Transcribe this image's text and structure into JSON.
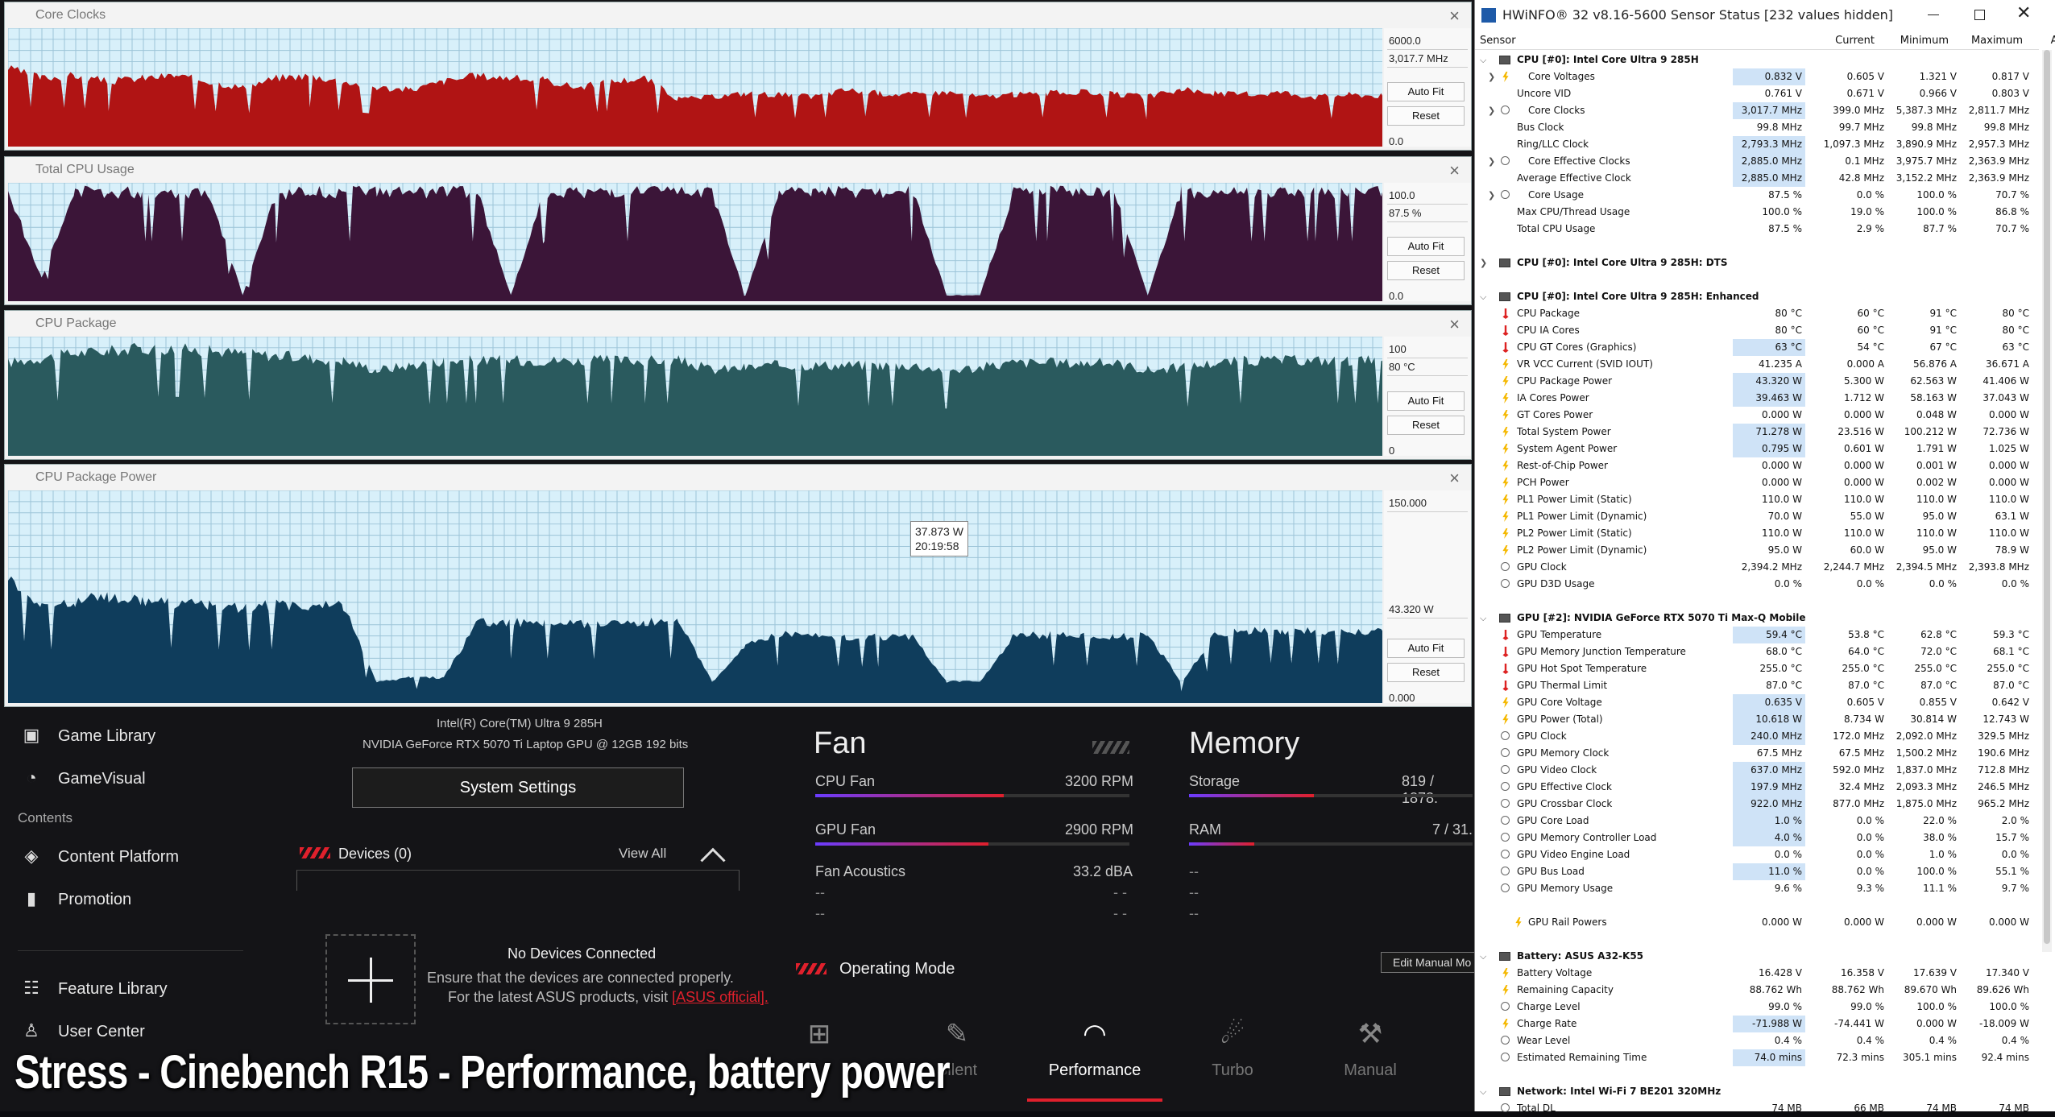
{
  "graphs": [
    {
      "title": "Core Clocks",
      "top_label": "6000.0",
      "current_label": "3,017.7 MHz",
      "bottom_label": "0.0",
      "autofit": "Auto Fit",
      "reset": "Reset",
      "color": "#b01414",
      "series": [
        0.66,
        0.58,
        0.6,
        0.55,
        0.58,
        0.6,
        0.55,
        0.5,
        0.58,
        0.6,
        0.55,
        0.5,
        0.48,
        0.55,
        0.6,
        0.58,
        0.56,
        0.5,
        0.55,
        0.58,
        0.4,
        0.42,
        0.45,
        0.44,
        0.42,
        0.48,
        0.45,
        0.44,
        0.46,
        0.42,
        0.44,
        0.45,
        0.46,
        0.44,
        0.42,
        0.48,
        0.45,
        0.44,
        0.46,
        0.42,
        0.44,
        0.43
      ]
    },
    {
      "title": "Total CPU Usage",
      "top_label": "100.0",
      "current_label": "87.5 %",
      "bottom_label": "0.0",
      "autofit": "Auto Fit",
      "reset": "Reset",
      "color": "#3b1538",
      "series": [
        0.92,
        0.2,
        0.92,
        0.92,
        0.92,
        0.92,
        0.92,
        0.05,
        0.9,
        0.92,
        0.92,
        0.92,
        0.92,
        0.92,
        0.92,
        0.05,
        0.92,
        0.92,
        0.92,
        0.92,
        0.92,
        0.92,
        0.05,
        0.92,
        0.92,
        0.92,
        0.92,
        0.92,
        0.05,
        0.05,
        0.92,
        0.92,
        0.92,
        0.92,
        0.05,
        0.92,
        0.92,
        0.92,
        0.92,
        0.92,
        0.92,
        0.92
      ]
    },
    {
      "title": "CPU Package",
      "top_label": "100",
      "current_label": "80 °C",
      "bottom_label": "0",
      "autofit": "Auto Fit",
      "reset": "Reset",
      "color": "#2a5a5e",
      "series": [
        0.78,
        0.82,
        0.86,
        0.88,
        0.9,
        0.9,
        0.88,
        0.86,
        0.84,
        0.82,
        0.8,
        0.72,
        0.76,
        0.8,
        0.8,
        0.8,
        0.8,
        0.8,
        0.8,
        0.8,
        0.8,
        0.72,
        0.74,
        0.76,
        0.76,
        0.76,
        0.76,
        0.76,
        0.72,
        0.74,
        0.78,
        0.78,
        0.78,
        0.78,
        0.72,
        0.74,
        0.78,
        0.8,
        0.8,
        0.8,
        0.8,
        0.8
      ]
    },
    {
      "title": "CPU Package Power",
      "top_label": "150.000",
      "current_label": "43.320 W",
      "bottom_label": "0.000",
      "autofit": "Auto Fit",
      "reset": "Reset",
      "color": "#0f3d5c",
      "series": [
        0.6,
        0.45,
        0.48,
        0.5,
        0.48,
        0.47,
        0.46,
        0.45,
        0.46,
        0.45,
        0.46,
        0.1,
        0.12,
        0.12,
        0.38,
        0.38,
        0.38,
        0.37,
        0.38,
        0.38,
        0.38,
        0.1,
        0.28,
        0.32,
        0.32,
        0.31,
        0.31,
        0.31,
        0.1,
        0.1,
        0.32,
        0.32,
        0.32,
        0.31,
        0.32,
        0.1,
        0.32,
        0.34,
        0.34,
        0.34,
        0.33,
        0.34
      ]
    }
  ],
  "tooltip": {
    "value": "37.873 W",
    "time": "20:19:58"
  },
  "armoury": {
    "nav": [
      {
        "icon": "game-library-icon",
        "glyph": "▣",
        "label": "Game Library"
      },
      {
        "icon": "gamevisual-icon",
        "glyph": "◔",
        "label": "GameVisual"
      }
    ],
    "contents_header": "Contents",
    "nav2": [
      {
        "icon": "content-platform-icon",
        "glyph": "◈",
        "label": "Content Platform"
      },
      {
        "icon": "promotion-icon",
        "glyph": "▮",
        "label": "Promotion"
      }
    ],
    "nav3": [
      {
        "icon": "feature-library-icon",
        "glyph": "☷",
        "label": "Feature Library"
      },
      {
        "icon": "user-center-icon",
        "glyph": "♙",
        "label": "User Center"
      }
    ],
    "cpu_name": "Intel(R) Core(TM) Ultra 9 285H",
    "gpu_name": "NVIDIA GeForce RTX 5070 Ti Laptop GPU @ 12GB 192 bits",
    "system_settings": "System Settings",
    "devices": "Devices (0)",
    "view_all": "View All",
    "no_devices": "No Devices Connected",
    "no_devices_desc1": "Ensure that the devices are connected properly.",
    "no_devices_desc2": "For the latest ASUS products, visit",
    "asus_link": "[ASUS official].",
    "fan_title": "Fan",
    "cpu_fan": "CPU Fan",
    "cpu_fan_val": "3200 RPM",
    "cpu_fan_level": 0.6,
    "gpu_fan": "GPU Fan",
    "gpu_fan_val": "2900 RPM",
    "gpu_fan_level": 0.55,
    "fan_acoustics": "Fan Acoustics",
    "fan_acoustics_val": "33.2 dBA",
    "dash": "--",
    "dash2": "- -",
    "memory_title": "Memory",
    "storage": "Storage",
    "storage_val": "819 / 1878.",
    "storage_level": 0.44,
    "ram": "RAM",
    "ram_val": "7 / 31.",
    "ram_level": 0.23,
    "operating_mode": "Operating Mode",
    "edit_manual": "Edit Manual Mo",
    "modes": [
      {
        "label": "",
        "icon": "windows-icon",
        "glyph": "⊞"
      },
      {
        "label": "Silent",
        "icon": "silent-icon",
        "glyph": "✎"
      },
      {
        "label": "Performance",
        "icon": "performance-icon",
        "glyph": "◠"
      },
      {
        "label": "Turbo",
        "icon": "turbo-icon",
        "glyph": "☄"
      },
      {
        "label": "Manual",
        "icon": "manual-icon",
        "glyph": "⚒"
      }
    ],
    "active_mode": "Performance"
  },
  "overlay_text": "Stress - Cinebench R15 - Performance, battery power",
  "hwinfo": {
    "title": "HWiNFO® 32 v8.16-5600 Sensor Status [232 values hidden]",
    "headers": [
      "Sensor",
      "Current",
      "Minimum",
      "Maximum",
      "Average"
    ],
    "rows": [
      {
        "t": "g",
        "name": "CPU [#0]: Intel Core Ultra 9 285H"
      },
      {
        "t": "r",
        "exp": true,
        "ic": "bolt",
        "name": "Core Voltages",
        "v": [
          "0.832 V",
          "0.605 V",
          "1.321 V",
          "0.817 V"
        ],
        "hl": true
      },
      {
        "t": "r",
        "name": "Uncore VID",
        "v": [
          "0.761 V",
          "0.671 V",
          "0.966 V",
          "0.803 V"
        ]
      },
      {
        "t": "r",
        "exp": true,
        "ic": "clock",
        "name": "Core Clocks",
        "v": [
          "3,017.7 MHz",
          "399.0 MHz",
          "5,387.3 MHz",
          "2,811.7 MHz"
        ],
        "hl": true
      },
      {
        "t": "r",
        "name": "Bus Clock",
        "v": [
          "99.8 MHz",
          "99.7 MHz",
          "99.8 MHz",
          "99.8 MHz"
        ]
      },
      {
        "t": "r",
        "name": "Ring/LLC Clock",
        "v": [
          "2,793.3 MHz",
          "1,097.3 MHz",
          "3,890.9 MHz",
          "2,957.3 MHz"
        ],
        "hl": true
      },
      {
        "t": "r",
        "exp": true,
        "ic": "clock",
        "name": "Core Effective Clocks",
        "v": [
          "2,885.0 MHz",
          "0.1 MHz",
          "3,975.7 MHz",
          "2,363.9 MHz"
        ],
        "hl": true
      },
      {
        "t": "r",
        "name": "Average Effective Clock",
        "v": [
          "2,885.0 MHz",
          "42.8 MHz",
          "3,152.2 MHz",
          "2,363.9 MHz"
        ],
        "hl": true
      },
      {
        "t": "r",
        "exp": true,
        "ic": "clock",
        "name": "Core Usage",
        "v": [
          "87.5 %",
          "0.0 %",
          "100.0 %",
          "70.7 %"
        ]
      },
      {
        "t": "r",
        "name": "Max CPU/Thread Usage",
        "v": [
          "100.0 %",
          "19.0 %",
          "100.0 %",
          "86.8 %"
        ]
      },
      {
        "t": "r",
        "name": "Total CPU Usage",
        "v": [
          "87.5 %",
          "2.9 %",
          "87.7 %",
          "70.7 %"
        ]
      },
      {
        "t": "s"
      },
      {
        "t": "g",
        "collapsed": true,
        "name": "CPU [#0]: Intel Core Ultra 9 285H: DTS"
      },
      {
        "t": "s"
      },
      {
        "t": "g",
        "name": "CPU [#0]: Intel Core Ultra 9 285H: Enhanced"
      },
      {
        "t": "r",
        "ic": "temp",
        "name": "CPU Package",
        "v": [
          "80 °C",
          "60 °C",
          "91 °C",
          "80 °C"
        ]
      },
      {
        "t": "r",
        "ic": "temp",
        "name": "CPU IA Cores",
        "v": [
          "80 °C",
          "60 °C",
          "91 °C",
          "80 °C"
        ]
      },
      {
        "t": "r",
        "ic": "temp",
        "name": "CPU GT Cores (Graphics)",
        "v": [
          "63 °C",
          "54 °C",
          "67 °C",
          "63 °C"
        ],
        "hl": true
      },
      {
        "t": "r",
        "ic": "bolt",
        "name": "VR VCC Current (SVID IOUT)",
        "v": [
          "41.235 A",
          "0.000 A",
          "56.876 A",
          "36.671 A"
        ]
      },
      {
        "t": "r",
        "ic": "bolt",
        "name": "CPU Package Power",
        "v": [
          "43.320 W",
          "5.300 W",
          "62.563 W",
          "41.406 W"
        ],
        "hl": true
      },
      {
        "t": "r",
        "ic": "bolt",
        "name": "IA Cores Power",
        "v": [
          "39.463 W",
          "1.712 W",
          "58.163 W",
          "37.043 W"
        ],
        "hl": true
      },
      {
        "t": "r",
        "ic": "bolt",
        "name": "GT Cores Power",
        "v": [
          "0.000 W",
          "0.000 W",
          "0.048 W",
          "0.000 W"
        ]
      },
      {
        "t": "r",
        "ic": "bolt",
        "name": "Total System Power",
        "v": [
          "71.278 W",
          "23.516 W",
          "100.212 W",
          "72.736 W"
        ],
        "hl": true
      },
      {
        "t": "r",
        "ic": "bolt",
        "name": "System Agent Power",
        "v": [
          "0.795 W",
          "0.601 W",
          "1.791 W",
          "1.025 W"
        ],
        "hl": true
      },
      {
        "t": "r",
        "ic": "bolt",
        "name": "Rest-of-Chip Power",
        "v": [
          "0.000 W",
          "0.000 W",
          "0.001 W",
          "0.000 W"
        ]
      },
      {
        "t": "r",
        "ic": "bolt",
        "name": "PCH Power",
        "v": [
          "0.000 W",
          "0.000 W",
          "0.002 W",
          "0.000 W"
        ]
      },
      {
        "t": "r",
        "ic": "bolt",
        "name": "PL1 Power Limit (Static)",
        "v": [
          "110.0 W",
          "110.0 W",
          "110.0 W",
          "110.0 W"
        ]
      },
      {
        "t": "r",
        "ic": "bolt",
        "name": "PL1 Power Limit (Dynamic)",
        "v": [
          "70.0 W",
          "55.0 W",
          "95.0 W",
          "63.1 W"
        ]
      },
      {
        "t": "r",
        "ic": "bolt",
        "name": "PL2 Power Limit (Static)",
        "v": [
          "110.0 W",
          "110.0 W",
          "110.0 W",
          "110.0 W"
        ]
      },
      {
        "t": "r",
        "ic": "bolt",
        "name": "PL2 Power Limit (Dynamic)",
        "v": [
          "95.0 W",
          "60.0 W",
          "95.0 W",
          "78.9 W"
        ]
      },
      {
        "t": "r",
        "ic": "clock",
        "name": "GPU Clock",
        "v": [
          "2,394.2 MHz",
          "2,244.7 MHz",
          "2,394.5 MHz",
          "2,393.8 MHz"
        ]
      },
      {
        "t": "r",
        "ic": "clock",
        "name": "GPU D3D Usage",
        "v": [
          "0.0 %",
          "0.0 %",
          "0.0 %",
          "0.0 %"
        ]
      },
      {
        "t": "s"
      },
      {
        "t": "g",
        "name": "GPU [#2]: NVIDIA  GeForce RTX 5070 Ti Max-Q Mobile"
      },
      {
        "t": "r",
        "ic": "temp",
        "name": "GPU Temperature",
        "v": [
          "59.4 °C",
          "53.8 °C",
          "62.8 °C",
          "59.3 °C"
        ],
        "hl": true
      },
      {
        "t": "r",
        "ic": "temp",
        "name": "GPU Memory Junction Temperature",
        "v": [
          "68.0 °C",
          "64.0 °C",
          "72.0 °C",
          "68.1 °C"
        ]
      },
      {
        "t": "r",
        "ic": "temp",
        "name": "GPU Hot Spot Temperature",
        "v": [
          "255.0 °C",
          "255.0 °C",
          "255.0 °C",
          "255.0 °C"
        ]
      },
      {
        "t": "r",
        "ic": "temp",
        "name": "GPU Thermal Limit",
        "v": [
          "87.0 °C",
          "87.0 °C",
          "87.0 °C",
          "87.0 °C"
        ]
      },
      {
        "t": "r",
        "ic": "bolt",
        "name": "GPU Core Voltage",
        "v": [
          "0.635 V",
          "0.605 V",
          "0.855 V",
          "0.642 V"
        ],
        "hl": true
      },
      {
        "t": "r",
        "ic": "bolt",
        "name": "GPU Power (Total)",
        "v": [
          "10.618 W",
          "8.734 W",
          "30.814 W",
          "12.743 W"
        ],
        "hl": true
      },
      {
        "t": "r",
        "ic": "clock",
        "name": "GPU Clock",
        "v": [
          "240.0 MHz",
          "172.0 MHz",
          "2,092.0 MHz",
          "329.5 MHz"
        ],
        "hl": true
      },
      {
        "t": "r",
        "ic": "clock",
        "name": "GPU Memory Clock",
        "v": [
          "67.5 MHz",
          "67.5 MHz",
          "1,500.2 MHz",
          "190.6 MHz"
        ]
      },
      {
        "t": "r",
        "ic": "clock",
        "name": "GPU Video Clock",
        "v": [
          "637.0 MHz",
          "592.0 MHz",
          "1,837.0 MHz",
          "712.8 MHz"
        ],
        "hl": true
      },
      {
        "t": "r",
        "ic": "clock",
        "name": "GPU Effective Clock",
        "v": [
          "197.9 MHz",
          "32.4 MHz",
          "2,093.3 MHz",
          "246.5 MHz"
        ],
        "hl": true
      },
      {
        "t": "r",
        "ic": "clock",
        "name": "GPU Crossbar Clock",
        "v": [
          "922.0 MHz",
          "877.0 MHz",
          "1,875.0 MHz",
          "965.2 MHz"
        ],
        "hl": true
      },
      {
        "t": "r",
        "ic": "clock",
        "name": "GPU Core Load",
        "v": [
          "1.0 %",
          "0.0 %",
          "22.0 %",
          "2.0 %"
        ],
        "hl": true
      },
      {
        "t": "r",
        "ic": "clock",
        "name": "GPU Memory Controller Load",
        "v": [
          "4.0 %",
          "0.0 %",
          "38.0 %",
          "15.7 %"
        ],
        "hl": true
      },
      {
        "t": "r",
        "ic": "clock",
        "name": "GPU Video Engine Load",
        "v": [
          "0.0 %",
          "0.0 %",
          "1.0 %",
          "0.0 %"
        ]
      },
      {
        "t": "r",
        "ic": "clock",
        "name": "GPU Bus Load",
        "v": [
          "11.0 %",
          "0.0 %",
          "100.0 %",
          "55.1 %"
        ],
        "hl": true
      },
      {
        "t": "r",
        "ic": "clock",
        "name": "GPU Memory Usage",
        "v": [
          "9.6 %",
          "9.3 %",
          "11.1 %",
          "9.7 %"
        ]
      },
      {
        "t": "s"
      },
      {
        "t": "r",
        "exp2": true,
        "ic": "bolt",
        "name": "GPU Rail Powers",
        "v": [
          "0.000 W",
          "0.000 W",
          "0.000 W",
          "0.000 W"
        ]
      },
      {
        "t": "s"
      },
      {
        "t": "g",
        "name": "Battery: ASUS  A32-K55"
      },
      {
        "t": "r",
        "ic": "bolt",
        "name": "Battery Voltage",
        "v": [
          "16.428 V",
          "16.358 V",
          "17.639 V",
          "17.340 V"
        ]
      },
      {
        "t": "r",
        "ic": "bolt",
        "name": "Remaining Capacity",
        "v": [
          "88.762 Wh",
          "88.762 Wh",
          "89.670 Wh",
          "89.626 Wh"
        ]
      },
      {
        "t": "r",
        "ic": "clock",
        "name": "Charge Level",
        "v": [
          "99.0 %",
          "99.0 %",
          "100.0 %",
          "100.0 %"
        ]
      },
      {
        "t": "r",
        "ic": "bolt",
        "name": "Charge Rate",
        "v": [
          "-71.988 W",
          "-74.441 W",
          "0.000 W",
          "-18.009 W"
        ],
        "hl": true
      },
      {
        "t": "r",
        "ic": "clock",
        "name": "Wear Level",
        "v": [
          "0.4 %",
          "0.4 %",
          "0.4 %",
          "0.4 %"
        ]
      },
      {
        "t": "r",
        "ic": "clock",
        "name": "Estimated Remaining Time",
        "v": [
          "74.0 mins",
          "72.3 mins",
          "305.1 mins",
          "92.4 mins"
        ],
        "hl": true
      },
      {
        "t": "s"
      },
      {
        "t": "g",
        "name": "Network: Intel Wi-Fi 7 BE201 320MHz"
      },
      {
        "t": "r",
        "ic": "clock",
        "name": "Total DL",
        "v": [
          "74 MB",
          "66 MB",
          "74 MB",
          "74 MB"
        ]
      }
    ]
  }
}
